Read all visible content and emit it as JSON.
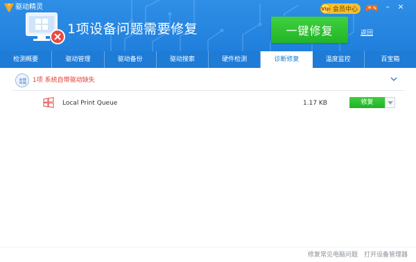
{
  "window": {
    "app_title": "驱动精灵",
    "vip_label": "会员中心",
    "vip_tag": "Vip",
    "minimize_glyph": "–",
    "close_glyph": "×"
  },
  "header": {
    "headline": "1项设备问题需要修复",
    "fix_all_label": "一键修复",
    "back_label": "返回"
  },
  "tabs": [
    {
      "label": "检测概要",
      "active": false
    },
    {
      "label": "驱动管理",
      "active": false
    },
    {
      "label": "驱动备份",
      "active": false
    },
    {
      "label": "驱动搜索",
      "active": false
    },
    {
      "label": "硬件检测",
      "active": false
    },
    {
      "label": "诊断修复",
      "active": true
    },
    {
      "label": "温度监控",
      "active": false
    },
    {
      "label": "百宝箱",
      "active": false
    }
  ],
  "group": {
    "label": "1项 系统自带驱动缺失"
  },
  "items": [
    {
      "name": "Local Print Queue",
      "size": "1.17 KB",
      "action_label": "修复"
    }
  ],
  "footer": {
    "fix_common_label": "修复常见电脑问题",
    "open_device_manager_label": "打开设备管理器"
  },
  "colors": {
    "header_blue": "#2f8fe6",
    "tab_blue": "#1e7bd6",
    "fix_green": "#2dbf2e",
    "alert_red": "#e03b32"
  }
}
